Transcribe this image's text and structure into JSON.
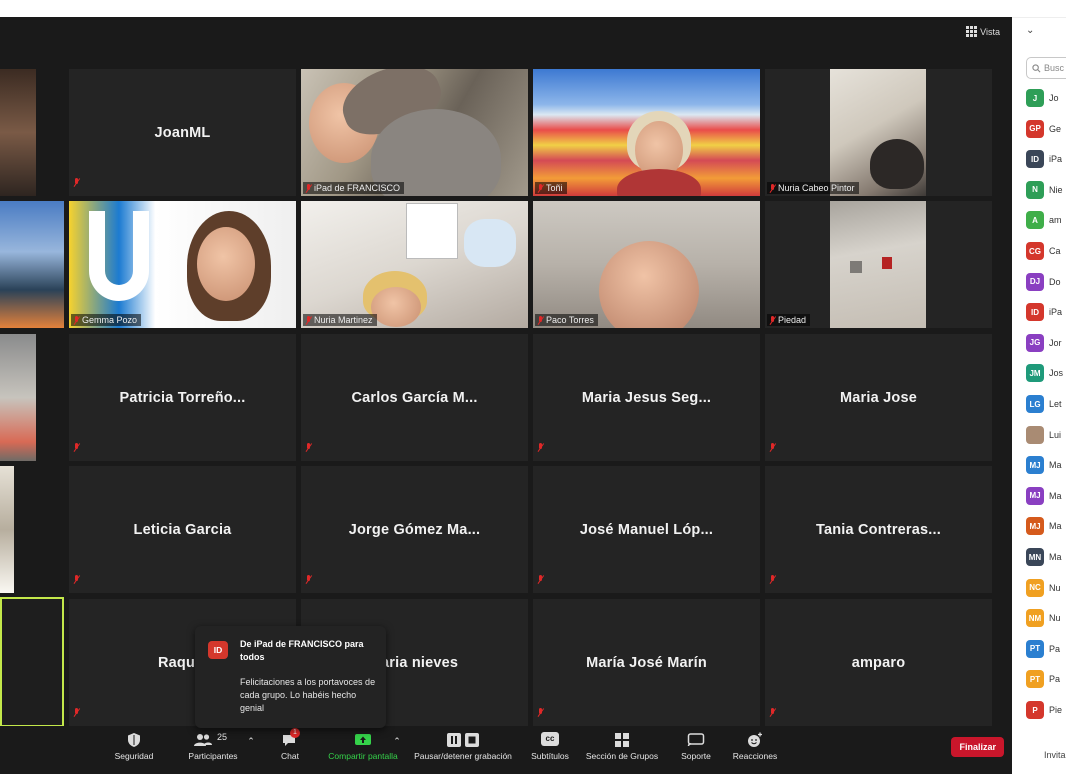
{
  "header": {
    "view_label": "Vista"
  },
  "tiles": {
    "r1c1": {
      "label": "JoanML"
    },
    "r1c2": {
      "label": "iPad de FRANCISCO"
    },
    "r1c3": {
      "label": "Toñi"
    },
    "r1c4": {
      "label": "Nuria Cabeo Pintor"
    },
    "r2c1": {
      "label": "Gemma Pozo"
    },
    "r2c2": {
      "label": "Nuria Martinez"
    },
    "r2c3": {
      "label": "Paco Torres"
    },
    "r2c4": {
      "label": "Piedad"
    },
    "r3c1": {
      "label": "Patricia  Torreño..."
    },
    "r3c2": {
      "label": "Carlos García M..."
    },
    "r3c3": {
      "label": "Maria Jesus Seg..."
    },
    "r3c4": {
      "label": "Maria Jose"
    },
    "r4c1": {
      "label": "Leticia Garcia"
    },
    "r4c2": {
      "label": "Jorge Gómez Ma..."
    },
    "r4c3": {
      "label": "José Manuel Lóp..."
    },
    "r4c4": {
      "label": "Tania Contreras..."
    },
    "r5c1": {
      "label": "Raqu"
    },
    "r5c2": {
      "label": "aria nieves"
    },
    "r5c3": {
      "label": "María José Marín"
    },
    "r5c4": {
      "label": "amparo"
    }
  },
  "chat_notification": {
    "avatar": "ID",
    "title": "De iPad de FRANCISCO para todos",
    "message": "Felicitaciones a los portavoces de cada grupo. Lo habéis hecho genial"
  },
  "toolbar": {
    "security": "Seguridad",
    "participants": "Participantes",
    "participants_count": "25",
    "chat": "Chat",
    "chat_badge": "1",
    "share": "Compartir pantalla",
    "record": "Pausar/detener grabación",
    "subtitles": "Subtítulos",
    "subtitles_icon_text": "cc",
    "breakout": "Sección de Grupos",
    "support": "Soporte",
    "reactions": "Reacciones",
    "end": "Finalizar"
  },
  "sidebar": {
    "chevron": "⌄",
    "search_placeholder": "Busc",
    "invite": "Invita",
    "participants": [
      {
        "initials": "J",
        "name": "Jo",
        "color": "#2e9e57"
      },
      {
        "initials": "GP",
        "name": "Ge",
        "color": "#d4372c"
      },
      {
        "initials": "ID",
        "name": "iPa",
        "color": "#3a4658"
      },
      {
        "initials": "N",
        "name": "Nie",
        "color": "#2e9e57"
      },
      {
        "initials": "A",
        "name": "am",
        "color": "#3fae49"
      },
      {
        "initials": "CG",
        "name": "Ca",
        "color": "#d4372c"
      },
      {
        "initials": "DJ",
        "name": "Do",
        "color": "#8a3fc1"
      },
      {
        "initials": "ID",
        "name": "iPa",
        "color": "#d4372c"
      },
      {
        "initials": "JG",
        "name": "Jor",
        "color": "#8a3fc1"
      },
      {
        "initials": "JM",
        "name": "Jos",
        "color": "#1f9a7a"
      },
      {
        "initials": "LG",
        "name": "Let",
        "color": "#2b7fd0"
      },
      {
        "initials": "",
        "name": "Lui",
        "color": "#a98b73"
      },
      {
        "initials": "MJ",
        "name": "Ma",
        "color": "#2b7fd0"
      },
      {
        "initials": "MJ",
        "name": "Ma",
        "color": "#8a3fc1"
      },
      {
        "initials": "MJ",
        "name": "Ma",
        "color": "#d55a1c"
      },
      {
        "initials": "MN",
        "name": "Ma",
        "color": "#3a4658"
      },
      {
        "initials": "NC",
        "name": "Nu",
        "color": "#f0a021"
      },
      {
        "initials": "NM",
        "name": "Nu",
        "color": "#f0a021"
      },
      {
        "initials": "PT",
        "name": "Pa",
        "color": "#2b7fd0"
      },
      {
        "initials": "PT",
        "name": "Pa",
        "color": "#f0a021"
      },
      {
        "initials": "P",
        "name": "Pie",
        "color": "#d4372c"
      }
    ]
  }
}
